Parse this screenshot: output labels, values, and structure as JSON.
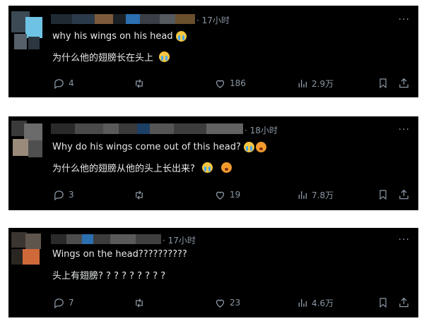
{
  "colors": {
    "card_bg": "#000000",
    "text": "#e7e9ea",
    "muted": "#8b98a5"
  },
  "icons": {
    "more": "more-dots-icon",
    "reply": "reply-icon",
    "repost": "repost-icon",
    "like": "heart-icon",
    "views": "views-icon",
    "bookmark": "bookmark-icon",
    "share": "share-icon",
    "emoji_cry": "loudly-crying-face-icon",
    "emoji_fear": "fearful-face-icon"
  },
  "more_label": "···",
  "posts": [
    {
      "time": "· 17小时",
      "line1": "why his wings on his head",
      "line2": "为什么他的翅膀长在头上",
      "replies": "4",
      "reposts": "",
      "likes": "186",
      "views": "2.9万"
    },
    {
      "time": "· 18小时",
      "line1": "Why do his wings come out of this head?",
      "line2": "为什么他的翅膀从他的头上长出来?",
      "replies": "3",
      "reposts": "",
      "likes": "19",
      "views": "7.8万"
    },
    {
      "time": "· 17小时",
      "line1": "Wings on the head??????????",
      "line2": "头上有翅膀? ? ? ? ? ? ? ? ?",
      "replies": "7",
      "reposts": "",
      "likes": "23",
      "views": "4.6万"
    }
  ]
}
